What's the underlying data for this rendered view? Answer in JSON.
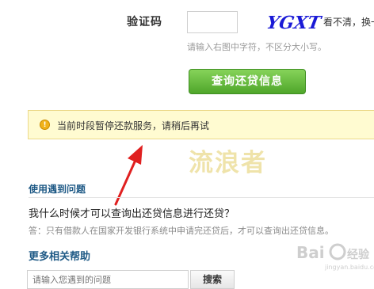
{
  "captcha": {
    "label": "验证码",
    "input_value": "",
    "code_text": "YGXT",
    "refresh_prefix": "看不清，",
    "refresh_link": "换一",
    "hint": "请输入右图中字符，不区分大小写。"
  },
  "query_button": {
    "label": "查询还贷信息"
  },
  "notice": {
    "icon": "warning-icon",
    "text": "当前时段暂停还款服务，请稍后再试"
  },
  "watermark": {
    "text": "流浪者"
  },
  "annotation": {
    "type": "red-arrow",
    "color": "#e02020"
  },
  "faq": {
    "title": "使用遇到问题",
    "question": "我什么时候才可以查询出还贷信息进行还贷？",
    "answer": "答：只有借款人在国家开发银行系统中申请完还贷后，才可以查询出还贷信息。"
  },
  "help": {
    "title": "更多相关帮助",
    "search_placeholder": "请输入您遇到的问题",
    "search_button": "搜索"
  },
  "colors": {
    "accent_green": "#5cb535",
    "link_blue": "#1f5a86",
    "notice_bg": "#fffbd1",
    "arrow_red": "#e02020"
  }
}
